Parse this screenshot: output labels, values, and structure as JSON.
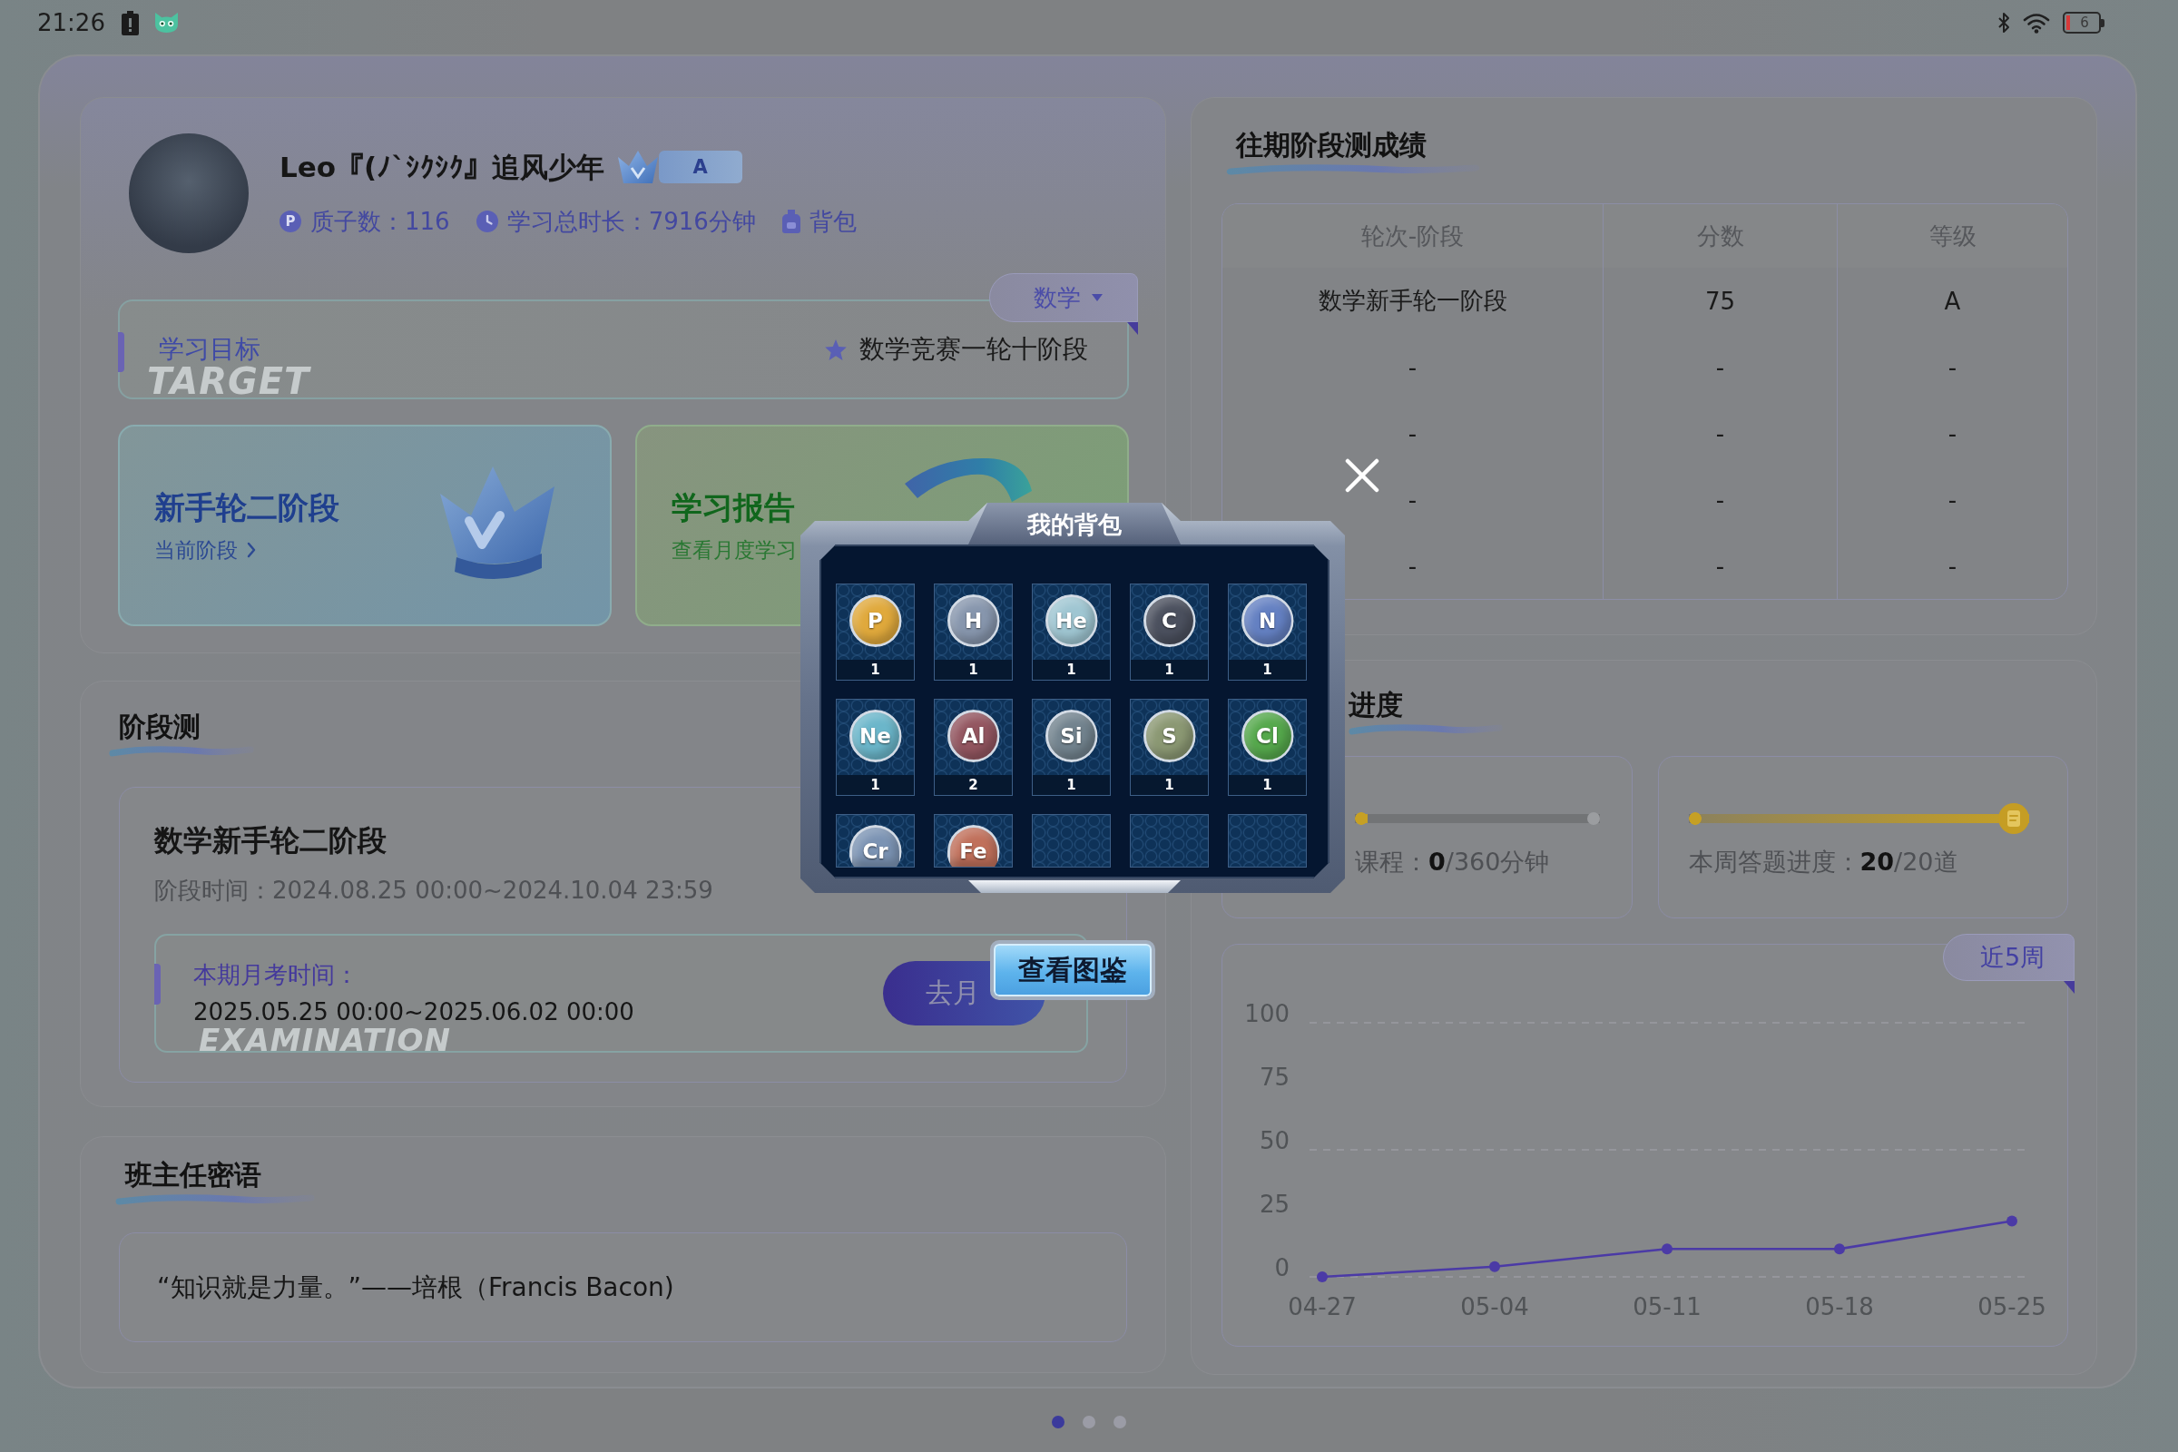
{
  "status_bar": {
    "time": "21:26",
    "battery": "6"
  },
  "profile": {
    "name": "Leo『(ﾉ`ｼｸｼｸ』追风少年",
    "rank": "A",
    "stats": [
      {
        "kind": "coin",
        "icon_label": "P",
        "text": "质子数：116"
      },
      {
        "kind": "clock",
        "text": "学习总时长：7916分钟"
      },
      {
        "kind": "backpack",
        "text": "背包"
      }
    ],
    "subject": "数学",
    "goal": {
      "label": "学习目标",
      "watermark": "TARGET",
      "value": "数学竞赛一轮十阶段"
    },
    "cards": [
      {
        "kind": "stage",
        "title": "新手轮二阶段",
        "link": "当前阶段"
      },
      {
        "kind": "report",
        "title": "学习报告",
        "link": "查看月度学习"
      }
    ]
  },
  "stage_test": {
    "title": "阶段测",
    "name": "数学新手轮二阶段",
    "period": "阶段时间：2024.08.25 00:00~2024.10.04 23:59",
    "exam_label": "本期月考时间：",
    "exam_time": "2025.05.25 00:00~2025.06.02 00:00",
    "watermark": "EXAMINATION",
    "exam_button": "去月"
  },
  "teacher_note": {
    "title": "班主任密语",
    "quote": "“知识就是力量。”——培根（Francis Bacon)"
  },
  "past_scores": {
    "title": "往期阶段测成绩",
    "columns": [
      "轮次-阶段",
      "分数",
      "等级"
    ],
    "rows": [
      [
        "数学新手轮一阶段",
        "75",
        "A"
      ],
      [
        "-",
        "-",
        "-"
      ],
      [
        "-",
        "-",
        "-"
      ],
      [
        "-",
        "-",
        "-"
      ],
      [
        "-",
        "-",
        "-"
      ]
    ]
  },
  "progress": {
    "title": "进度",
    "cards": [
      {
        "kind": "course",
        "label": "课程：**0**/360分钟",
        "level": 0
      },
      {
        "kind": "answers",
        "label": "本周答题进度：**20**/20道",
        "level": 1
      }
    ],
    "range": "近5周",
    "chart_data": {
      "type": "line",
      "categories": [
        "04-27",
        "05-04",
        "05-11",
        "05-18",
        "05-25"
      ],
      "series": [
        {
          "color": "#4b3aa6",
          "marker": true,
          "values": [
            0,
            4,
            11,
            11,
            22
          ]
        }
      ],
      "ylim": [
        0,
        100
      ],
      "yticks": [
        0,
        25,
        50,
        75,
        100
      ]
    }
  },
  "pagination": [
    {
      "selected": true
    },
    {
      "selected": false
    },
    {
      "selected": false
    }
  ],
  "backpack": {
    "title": "我的背包",
    "items": [
      {
        "kind": "element",
        "symbol": "P",
        "count": "1",
        "color": "#e0a93c"
      },
      {
        "kind": "element",
        "symbol": "H",
        "count": "1",
        "color": "#8796ad"
      },
      {
        "kind": "element",
        "symbol": "He",
        "count": "1",
        "color": "#9fc6d2"
      },
      {
        "kind": "element",
        "symbol": "C",
        "count": "1",
        "color": "#4b505e"
      },
      {
        "kind": "element",
        "symbol": "N",
        "count": "1",
        "color": "#6480c2"
      },
      {
        "kind": "element",
        "symbol": "Ne",
        "count": "1",
        "color": "#6bb6ca"
      },
      {
        "kind": "element",
        "symbol": "Al",
        "count": "2",
        "color": "#935660"
      },
      {
        "kind": "element",
        "symbol": "Si",
        "count": "1",
        "color": "#72838e"
      },
      {
        "kind": "element",
        "symbol": "S",
        "count": "1",
        "color": "#8b9873"
      },
      {
        "kind": "element",
        "symbol": "Cl",
        "count": "1",
        "color": "#55a84c"
      },
      {
        "kind": "element",
        "symbol": "Cr",
        "color": "#7b93b3"
      },
      {
        "kind": "element",
        "symbol": "Fe",
        "color": "#c0705b"
      },
      {
        "kind": "empty"
      },
      {
        "kind": "empty"
      },
      {
        "kind": "empty"
      }
    ],
    "button": "查看图鉴"
  }
}
